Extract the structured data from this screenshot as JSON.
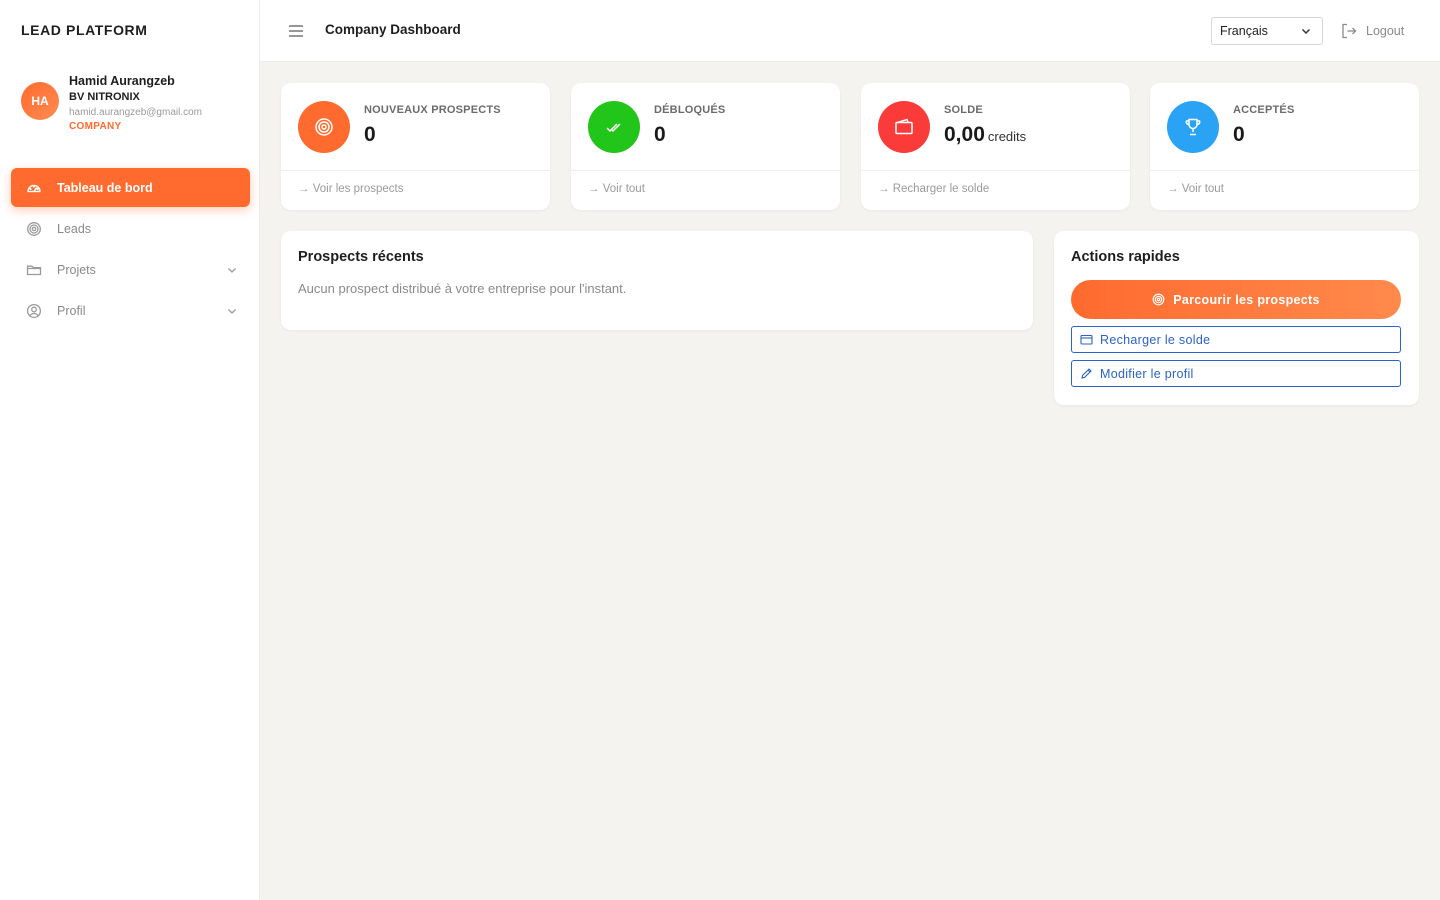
{
  "brand": "LEAD PLATFORM",
  "user": {
    "initials": "HA",
    "name": "Hamid Aurangzeb",
    "company": "BV NITRONIX",
    "email": "hamid.aurangzeb@gmail.com",
    "role": "COMPANY"
  },
  "nav": {
    "items": [
      {
        "label": "Tableau de bord",
        "icon": "dashboard-gauge-icon",
        "active": true
      },
      {
        "label": "Leads",
        "icon": "target-icon"
      },
      {
        "label": "Projets",
        "icon": "folder-icon",
        "expandable": true
      },
      {
        "label": "Profil",
        "icon": "user-circle-icon",
        "expandable": true
      }
    ]
  },
  "topbar": {
    "title": "Company Dashboard",
    "language": "Français",
    "logout": "Logout"
  },
  "stats": [
    {
      "label": "NOUVEAUX PROSPECTS",
      "value": "0",
      "link": "Voir les prospects",
      "color": "#ff6a2e",
      "icon": "target-icon"
    },
    {
      "label": "DÉBLOQUÉS",
      "value": "0",
      "link": "Voir tout",
      "color": "#22c51a",
      "icon": "double-check-icon"
    },
    {
      "label": "SOLDE",
      "value": "0,00",
      "unit": "credits",
      "link": "Recharger le solde",
      "color": "#fb3a3a",
      "icon": "wallet-icon"
    },
    {
      "label": "ACCEPTÉS",
      "value": "0",
      "link": "Voir tout",
      "color": "#2aa3f5",
      "icon": "trophy-icon"
    }
  ],
  "recent": {
    "title": "Prospects récents",
    "empty": "Aucun prospect distribué à votre entreprise pour l'instant."
  },
  "actions": {
    "title": "Actions rapides",
    "browse": "Parcourir les prospects",
    "recharge": "Recharger le solde",
    "edit_profile": "Modifier le profil"
  },
  "colors": {
    "accent": "#ff6a2e",
    "link_blue": "#2b63c9",
    "background": "#f4f3f0"
  }
}
